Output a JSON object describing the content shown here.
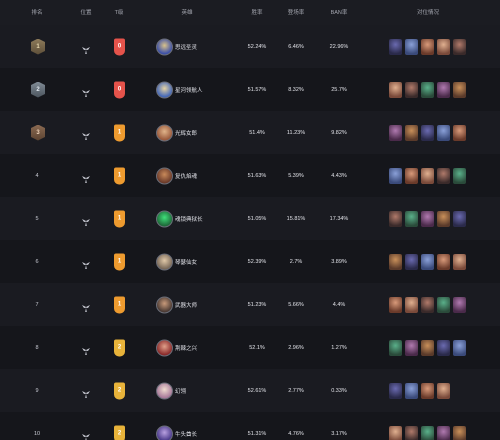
{
  "header": {
    "rank": "排名",
    "role": "位置",
    "tier": "T级",
    "hero": "英雄",
    "win_rate": "胜率",
    "pick_rate": "登场率",
    "ban_rate": "BAN率",
    "counters": "对位情况"
  },
  "rows": [
    {
      "rank": "1",
      "medal": "gold",
      "tier": "0",
      "hero": "思远圣灵",
      "win_rate": "52.24%",
      "pick_rate": "6.46%",
      "ban_rate": "22.96%"
    },
    {
      "rank": "2",
      "medal": "silver",
      "tier": "0",
      "hero": "星河领航人",
      "win_rate": "51.57%",
      "pick_rate": "8.32%",
      "ban_rate": "25.7%"
    },
    {
      "rank": "3",
      "medal": "bronze",
      "tier": "1",
      "hero": "光辉女郎",
      "win_rate": "51.4%",
      "pick_rate": "11.23%",
      "ban_rate": "9.82%"
    },
    {
      "rank": "4",
      "tier": "1",
      "hero": "复仇焰魂",
      "win_rate": "51.63%",
      "pick_rate": "5.39%",
      "ban_rate": "4.43%"
    },
    {
      "rank": "5",
      "tier": "1",
      "hero": "魂锁典狱长",
      "win_rate": "51.05%",
      "pick_rate": "15.81%",
      "ban_rate": "17.34%"
    },
    {
      "rank": "6",
      "tier": "1",
      "hero": "琴瑟仙女",
      "win_rate": "52.39%",
      "pick_rate": "2.7%",
      "ban_rate": "3.89%"
    },
    {
      "rank": "7",
      "tier": "1",
      "hero": "武器大师",
      "win_rate": "51.23%",
      "pick_rate": "5.66%",
      "ban_rate": "4.4%"
    },
    {
      "rank": "8",
      "tier": "2",
      "hero": "荆棘之兴",
      "win_rate": "52.1%",
      "pick_rate": "2.96%",
      "ban_rate": "1.27%"
    },
    {
      "rank": "9",
      "tier": "2",
      "hero": "幻翎",
      "win_rate": "52.61%",
      "pick_rate": "2.77%",
      "ban_rate": "0.33%"
    },
    {
      "rank": "10",
      "tier": "2",
      "hero": "牛头酋长",
      "win_rate": "51.31%",
      "pick_rate": "4.76%",
      "ban_rate": "3.17%"
    }
  ],
  "colors": {
    "tier_0": "#e5534b",
    "tier_1": "#ee9b2f",
    "tier_2": "#e8b33a",
    "background": "#17181d"
  }
}
